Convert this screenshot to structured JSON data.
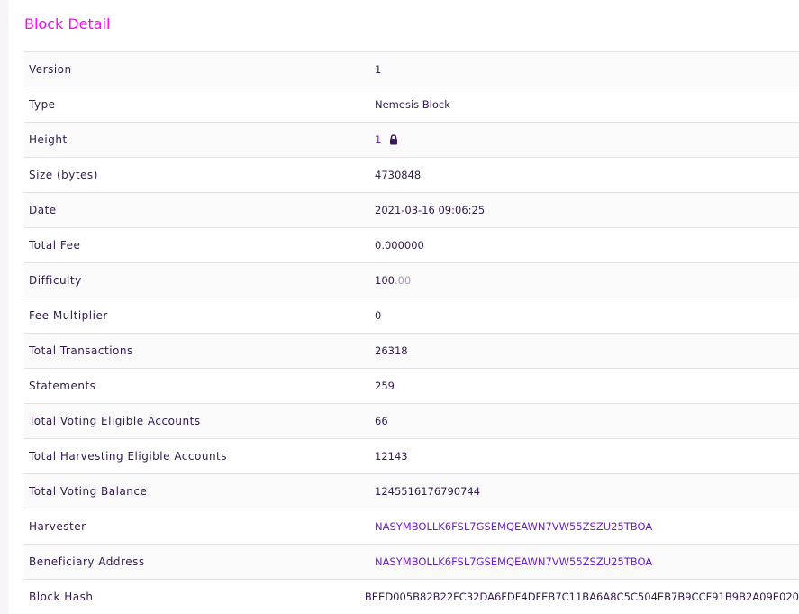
{
  "title": "Block Detail",
  "rows": [
    {
      "key": "Version",
      "value": "1"
    },
    {
      "key": "Type",
      "value": "Nemesis Block"
    },
    {
      "key": "Height",
      "value": "1"
    },
    {
      "key": "Size (bytes)",
      "value": "4730848"
    },
    {
      "key": "Date",
      "value": "2021-03-16 09:06:25"
    },
    {
      "key": "Total Fee",
      "value": "0.000000"
    },
    {
      "key": "Difficulty",
      "value_int": "100",
      "value_dec": ".00"
    },
    {
      "key": "Fee Multiplier",
      "value": "0"
    },
    {
      "key": "Total Transactions",
      "value": "26318"
    },
    {
      "key": "Statements",
      "value": "259"
    },
    {
      "key": "Total Voting Eligible Accounts",
      "value": "66"
    },
    {
      "key": "Total Harvesting Eligible Accounts",
      "value": "12143"
    },
    {
      "key": "Total Voting Balance",
      "value": "1245516176790744"
    },
    {
      "key": "Harvester",
      "value": "NASYMBOLLK6FSL7GSEMQEAWN7VW55ZSZU25TBOA"
    },
    {
      "key": "Beneficiary Address",
      "value": "NASYMBOLLK6FSL7GSEMQEAWN7VW55ZSZU25TBOA"
    },
    {
      "key": "Block Hash",
      "value": "BEED005B82B22FC32DA6FDF4DFEB7C11BA6A8C5C504EB7B9CCF91B9B2A09E020"
    }
  ],
  "icons": {
    "height_lock": "lock-icon"
  },
  "colors": {
    "title": "#ff00ff",
    "link": "#6a1fc7",
    "text": "#33194d"
  }
}
